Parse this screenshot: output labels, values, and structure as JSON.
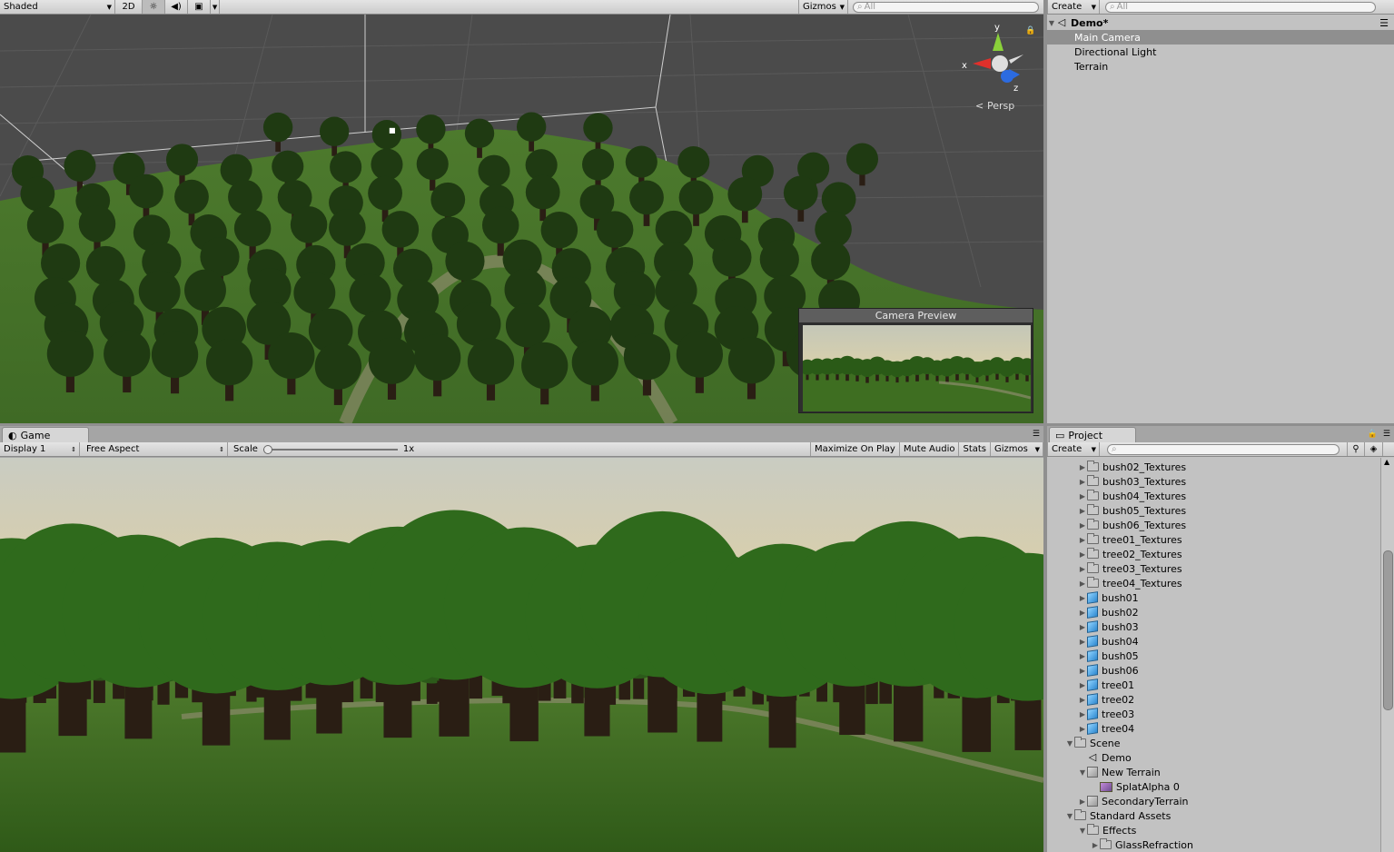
{
  "scene_view": {
    "shading_mode": "Shaded",
    "mode_2d": "2D",
    "gizmos": "Gizmos",
    "search_placeholder": "All",
    "axis_y": "y",
    "axis_x": "x",
    "axis_z": "z",
    "projection": "Persp",
    "camera_preview_title": "Camera Preview"
  },
  "hierarchy": {
    "create": "Create",
    "search_placeholder": "All",
    "scene_name": "Demo*",
    "items": [
      "Main Camera",
      "Directional Light",
      "Terrain"
    ],
    "selected_index": 0
  },
  "game_view": {
    "tab": "Game",
    "display": "Display 1",
    "aspect": "Free Aspect",
    "scale_label": "Scale",
    "scale_value": "1x",
    "maximize_on_play": "Maximize On Play",
    "mute_audio": "Mute Audio",
    "stats": "Stats",
    "gizmos": "Gizmos"
  },
  "project": {
    "tab": "Project",
    "create": "Create",
    "items": [
      {
        "label": "bush02_Textures",
        "type": "folder",
        "depth": 2,
        "expand": "closed"
      },
      {
        "label": "bush03_Textures",
        "type": "folder",
        "depth": 2,
        "expand": "closed"
      },
      {
        "label": "bush04_Textures",
        "type": "folder",
        "depth": 2,
        "expand": "closed"
      },
      {
        "label": "bush05_Textures",
        "type": "folder",
        "depth": 2,
        "expand": "closed"
      },
      {
        "label": "bush06_Textures",
        "type": "folder",
        "depth": 2,
        "expand": "closed"
      },
      {
        "label": "tree01_Textures",
        "type": "folder",
        "depth": 2,
        "expand": "closed"
      },
      {
        "label": "tree02_Textures",
        "type": "folder",
        "depth": 2,
        "expand": "closed"
      },
      {
        "label": "tree03_Textures",
        "type": "folder",
        "depth": 2,
        "expand": "closed"
      },
      {
        "label": "tree04_Textures",
        "type": "folder",
        "depth": 2,
        "expand": "closed"
      },
      {
        "label": "bush01",
        "type": "cube",
        "depth": 2,
        "expand": "closed"
      },
      {
        "label": "bush02",
        "type": "cube",
        "depth": 2,
        "expand": "closed"
      },
      {
        "label": "bush03",
        "type": "cube",
        "depth": 2,
        "expand": "closed"
      },
      {
        "label": "bush04",
        "type": "cube",
        "depth": 2,
        "expand": "closed"
      },
      {
        "label": "bush05",
        "type": "cube",
        "depth": 2,
        "expand": "closed"
      },
      {
        "label": "bush06",
        "type": "cube",
        "depth": 2,
        "expand": "closed"
      },
      {
        "label": "tree01",
        "type": "cube",
        "depth": 2,
        "expand": "closed"
      },
      {
        "label": "tree02",
        "type": "cube",
        "depth": 2,
        "expand": "closed"
      },
      {
        "label": "tree03",
        "type": "cube",
        "depth": 2,
        "expand": "closed"
      },
      {
        "label": "tree04",
        "type": "cube",
        "depth": 2,
        "expand": "closed"
      },
      {
        "label": "Scene",
        "type": "folder",
        "depth": 1,
        "expand": "open"
      },
      {
        "label": "Demo",
        "type": "unity",
        "depth": 2,
        "expand": "none"
      },
      {
        "label": "New Terrain",
        "type": "prefab",
        "depth": 2,
        "expand": "open"
      },
      {
        "label": "SplatAlpha 0",
        "type": "texture",
        "depth": 3,
        "expand": "none"
      },
      {
        "label": "SecondaryTerrain",
        "type": "prefab",
        "depth": 2,
        "expand": "closed"
      },
      {
        "label": "Standard Assets",
        "type": "folder",
        "depth": 1,
        "expand": "open"
      },
      {
        "label": "Effects",
        "type": "folder",
        "depth": 2,
        "expand": "open"
      },
      {
        "label": "GlassRefraction",
        "type": "folder",
        "depth": 3,
        "expand": "closed"
      }
    ]
  }
}
